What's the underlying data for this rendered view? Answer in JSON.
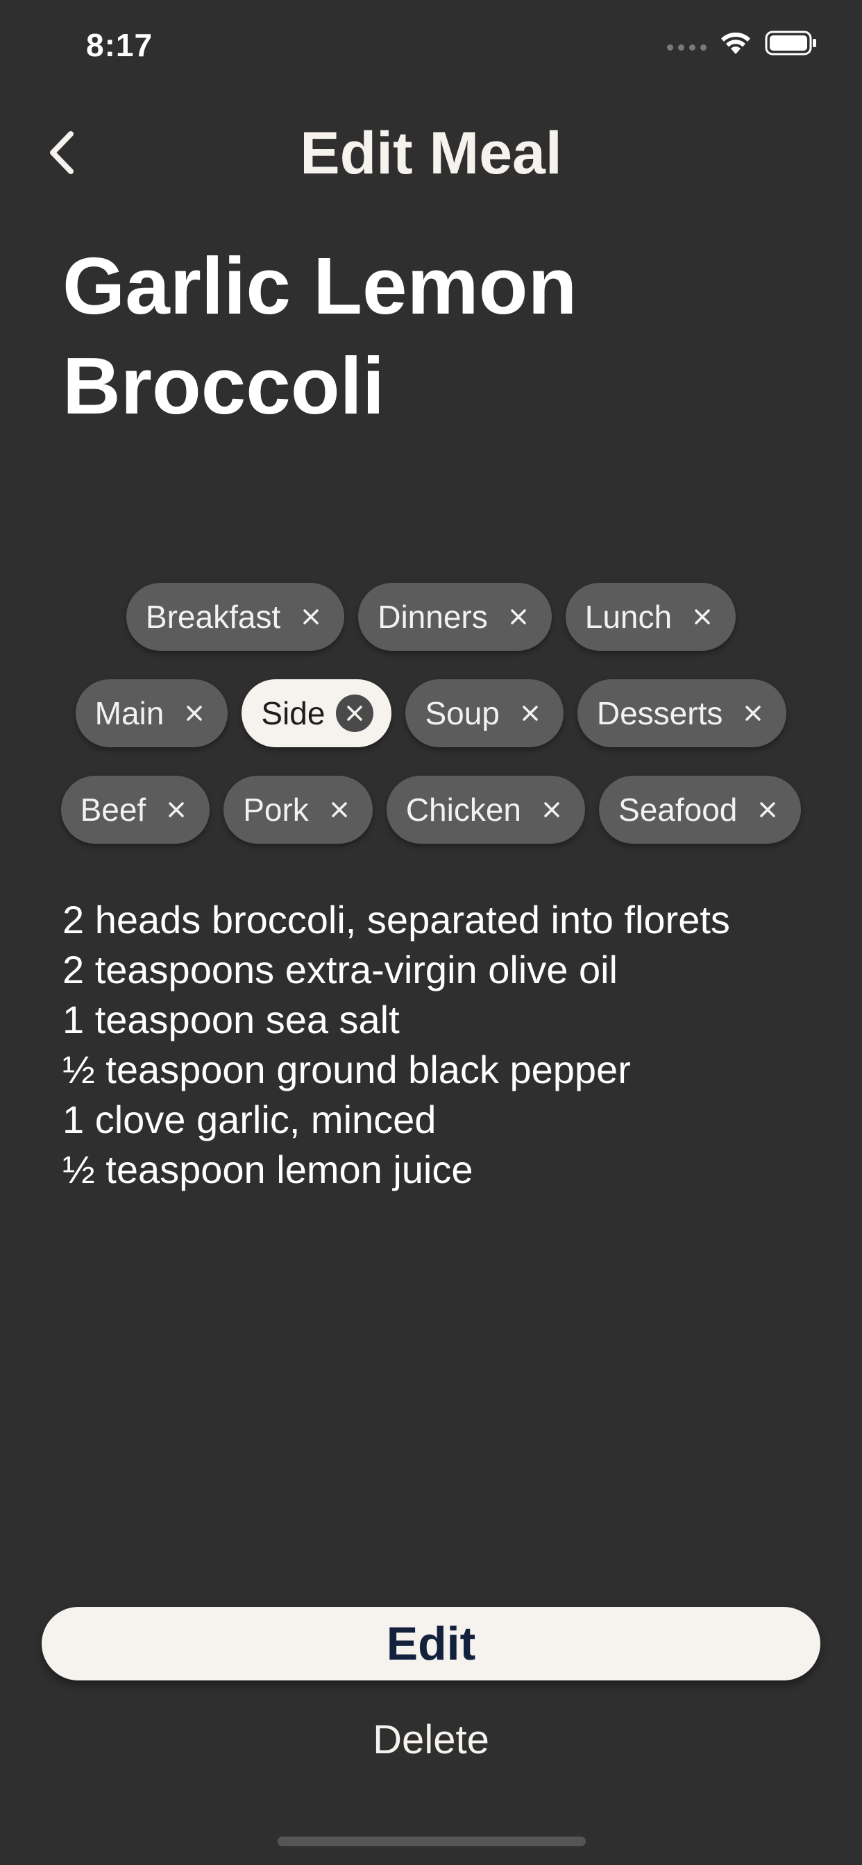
{
  "status_bar": {
    "time": "8:17"
  },
  "header": {
    "title": "Edit Meal",
    "back_icon": "chevron-left-icon"
  },
  "meal": {
    "name": "Garlic Lemon Broccoli"
  },
  "tags": {
    "rows": [
      [
        {
          "label": "Breakfast",
          "selected": false
        },
        {
          "label": "Dinners",
          "selected": false
        },
        {
          "label": "Lunch",
          "selected": false
        }
      ],
      [
        {
          "label": "Main",
          "selected": false
        },
        {
          "label": "Side",
          "selected": true
        },
        {
          "label": "Soup",
          "selected": false
        },
        {
          "label": "Desserts",
          "selected": false
        }
      ],
      [
        {
          "label": "Beef",
          "selected": false
        },
        {
          "label": "Pork",
          "selected": false
        },
        {
          "label": "Chicken",
          "selected": false
        },
        {
          "label": "Seafood",
          "selected": false
        }
      ]
    ]
  },
  "ingredients": [
    "2 heads broccoli, separated into florets",
    "2 teaspoons extra-virgin olive oil",
    "1 teaspoon sea salt",
    "½ teaspoon ground black pepper",
    "1 clove garlic, minced",
    "½ teaspoon lemon juice"
  ],
  "actions": {
    "edit_label": "Edit",
    "delete_label": "Delete"
  },
  "colors": {
    "background": "#2f2f2f",
    "tag": "#5c5c5c",
    "selected_tag": "#f6f3ef",
    "edit_button_text": "#14213d"
  }
}
